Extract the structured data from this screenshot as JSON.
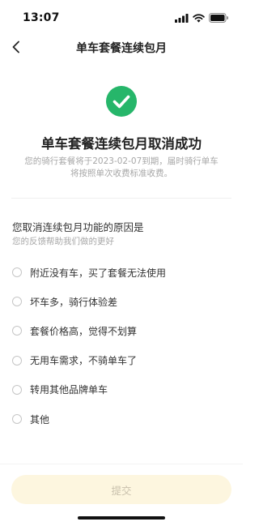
{
  "status_bar": {
    "time": "13:07"
  },
  "nav": {
    "title": "单车套餐连续包月"
  },
  "result": {
    "title": "单车套餐连续包月取消成功",
    "description": "您的骑行套餐将于2023-02-07到期，届时骑行单车将按照单次收费标准收费。"
  },
  "reasons": {
    "title": "您取消连续包月功能的原因是",
    "subtitle": "您的反馈帮助我们做的更好",
    "items": [
      {
        "label": "附近没有车，买了套餐无法使用"
      },
      {
        "label": "坏车多，骑行体验差"
      },
      {
        "label": "套餐价格高，觉得不划算"
      },
      {
        "label": "无用车需求，不骑单车了"
      },
      {
        "label": "转用其他品牌单车"
      },
      {
        "label": "其他"
      }
    ]
  },
  "submit": {
    "label": "提交"
  },
  "colors": {
    "success_green": "#26b66a",
    "submit_bg": "#fdf6df",
    "submit_text": "#c9c1ad"
  }
}
